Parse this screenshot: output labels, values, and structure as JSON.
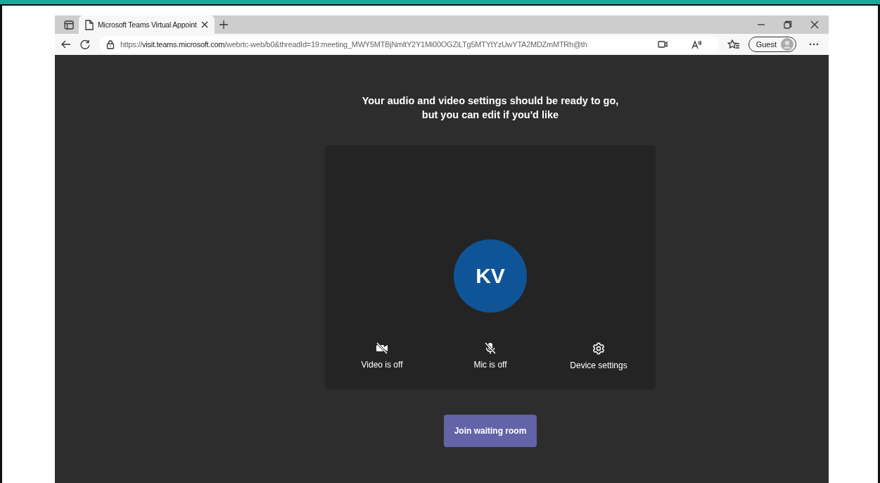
{
  "browser": {
    "tab": {
      "title": "Microsoft Teams Virtual Appoint",
      "selected": true
    },
    "url": {
      "scheme": "https://",
      "host": "visit.teams.microsoft.com",
      "path": "/webrtc-web/b0&threadId=19:meeting_MWY5MTBjNmltY2Y1Mi00OGZiLTg5MTYtYzUwYTA2MDZmMTRh@th"
    },
    "profile": {
      "label": "Guest"
    }
  },
  "lobby": {
    "heading": [
      "Your audio and video settings should be ready to go,",
      "but you can edit if you'd like"
    ],
    "avatar": {
      "initials": "KV",
      "color": "#0f5496"
    },
    "controls": [
      {
        "kind": "camera",
        "label": "Video is off",
        "on": false
      },
      {
        "kind": "mic",
        "label": "Mic is off",
        "on": false
      },
      {
        "kind": "settings",
        "label": "Device settings"
      }
    ],
    "join_button": {
      "label": "Join waiting room"
    }
  }
}
